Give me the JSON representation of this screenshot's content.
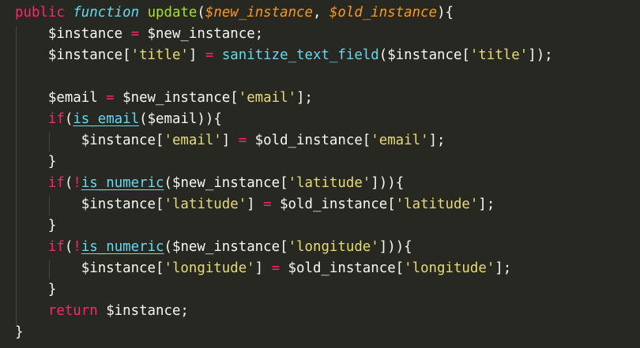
{
  "theme": {
    "background": "#272822",
    "foreground": "#f8f8f2",
    "keyword": "#f92672",
    "storage": "#66d9ef",
    "string": "#e6db74",
    "parameter": "#fd971f",
    "function_name": "#a6e22e",
    "indent_guide": "#464741"
  },
  "code": {
    "lines": [
      [
        {
          "t": "public",
          "k": "kw"
        },
        {
          "t": " ",
          "k": "pl"
        },
        {
          "t": "function",
          "k": "fn it"
        },
        {
          "t": " ",
          "k": "pl"
        },
        {
          "t": "update",
          "k": "def"
        },
        {
          "t": "(",
          "k": "pl"
        },
        {
          "t": "$new_instance",
          "k": "arg"
        },
        {
          "t": ", ",
          "k": "pl"
        },
        {
          "t": "$old_instance",
          "k": "arg"
        },
        {
          "t": "){",
          "k": "pl"
        }
      ],
      [
        {
          "t": "    $instance ",
          "k": "pl"
        },
        {
          "t": "=",
          "k": "kw"
        },
        {
          "t": " $new_instance;",
          "k": "pl"
        }
      ],
      [
        {
          "t": "    $instance[",
          "k": "pl"
        },
        {
          "t": "'title'",
          "k": "str"
        },
        {
          "t": "] ",
          "k": "pl"
        },
        {
          "t": "=",
          "k": "kw"
        },
        {
          "t": " ",
          "k": "pl"
        },
        {
          "t": "sanitize_text_field",
          "k": "fn"
        },
        {
          "t": "($instance[",
          "k": "pl"
        },
        {
          "t": "'title'",
          "k": "str"
        },
        {
          "t": "]);",
          "k": "pl"
        }
      ],
      [],
      [
        {
          "t": "    $email ",
          "k": "pl"
        },
        {
          "t": "=",
          "k": "kw"
        },
        {
          "t": " $new_instance[",
          "k": "pl"
        },
        {
          "t": "'email'",
          "k": "str"
        },
        {
          "t": "];",
          "k": "pl"
        }
      ],
      [
        {
          "t": "    ",
          "k": "pl"
        },
        {
          "t": "if",
          "k": "kw"
        },
        {
          "t": "(",
          "k": "pl"
        },
        {
          "t": "is_email",
          "k": "fn link"
        },
        {
          "t": "($email)){",
          "k": "pl"
        }
      ],
      [
        {
          "t": "        $instance[",
          "k": "pl"
        },
        {
          "t": "'email'",
          "k": "str"
        },
        {
          "t": "] ",
          "k": "pl"
        },
        {
          "t": "=",
          "k": "kw"
        },
        {
          "t": " $old_instance[",
          "k": "pl"
        },
        {
          "t": "'email'",
          "k": "str"
        },
        {
          "t": "];",
          "k": "pl"
        }
      ],
      [
        {
          "t": "    }",
          "k": "pl"
        }
      ],
      [
        {
          "t": "    ",
          "k": "pl"
        },
        {
          "t": "if",
          "k": "kw"
        },
        {
          "t": "(",
          "k": "pl"
        },
        {
          "t": "!",
          "k": "kw"
        },
        {
          "t": "is_numeric",
          "k": "fn link"
        },
        {
          "t": "($new_instance[",
          "k": "pl"
        },
        {
          "t": "'latitude'",
          "k": "str"
        },
        {
          "t": "])){",
          "k": "pl"
        }
      ],
      [
        {
          "t": "        $instance[",
          "k": "pl"
        },
        {
          "t": "'latitude'",
          "k": "str"
        },
        {
          "t": "] ",
          "k": "pl"
        },
        {
          "t": "=",
          "k": "kw"
        },
        {
          "t": " $old_instance[",
          "k": "pl"
        },
        {
          "t": "'latitude'",
          "k": "str"
        },
        {
          "t": "];",
          "k": "pl"
        }
      ],
      [
        {
          "t": "    }",
          "k": "pl"
        }
      ],
      [
        {
          "t": "    ",
          "k": "pl"
        },
        {
          "t": "if",
          "k": "kw"
        },
        {
          "t": "(",
          "k": "pl"
        },
        {
          "t": "!",
          "k": "kw"
        },
        {
          "t": "is_numeric",
          "k": "fn link"
        },
        {
          "t": "($new_instance[",
          "k": "pl"
        },
        {
          "t": "'longitude'",
          "k": "str"
        },
        {
          "t": "])){",
          "k": "pl"
        }
      ],
      [
        {
          "t": "        $instance[",
          "k": "pl"
        },
        {
          "t": "'longitude'",
          "k": "str"
        },
        {
          "t": "] ",
          "k": "pl"
        },
        {
          "t": "=",
          "k": "kw"
        },
        {
          "t": " $old_instance[",
          "k": "pl"
        },
        {
          "t": "'longitude'",
          "k": "str"
        },
        {
          "t": "];",
          "k": "pl"
        }
      ],
      [
        {
          "t": "    }",
          "k": "pl"
        }
      ],
      [
        {
          "t": "    ",
          "k": "pl"
        },
        {
          "t": "return",
          "k": "kw"
        },
        {
          "t": " $instance;",
          "k": "pl"
        }
      ],
      [
        {
          "t": "}",
          "k": "pl"
        }
      ]
    ]
  }
}
